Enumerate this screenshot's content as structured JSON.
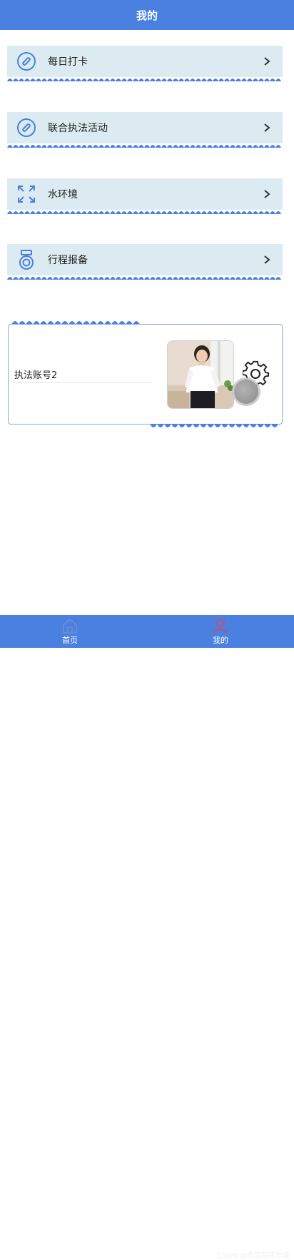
{
  "header": {
    "title": "我的"
  },
  "menu": {
    "items": [
      {
        "label": "每日打卡",
        "icon": "link-icon"
      },
      {
        "label": "联合执法活动",
        "icon": "link-icon"
      },
      {
        "label": "水环境",
        "icon": "expand-icon"
      },
      {
        "label": "行程报备",
        "icon": "medal-icon"
      }
    ]
  },
  "profile": {
    "account_name": "执法账号2"
  },
  "tabbar": {
    "tabs": [
      {
        "label": "首页",
        "icon": "home-icon"
      },
      {
        "label": "我的",
        "icon": "user-icon",
        "active": true
      }
    ]
  },
  "watermark": "CSDN @杰简程序毕设",
  "colors": {
    "primary": "#4a80e0",
    "menu_bg": "#dcebf2",
    "icon_blue": "#4a80e0",
    "active_tab_icon": "#d04a6a"
  }
}
